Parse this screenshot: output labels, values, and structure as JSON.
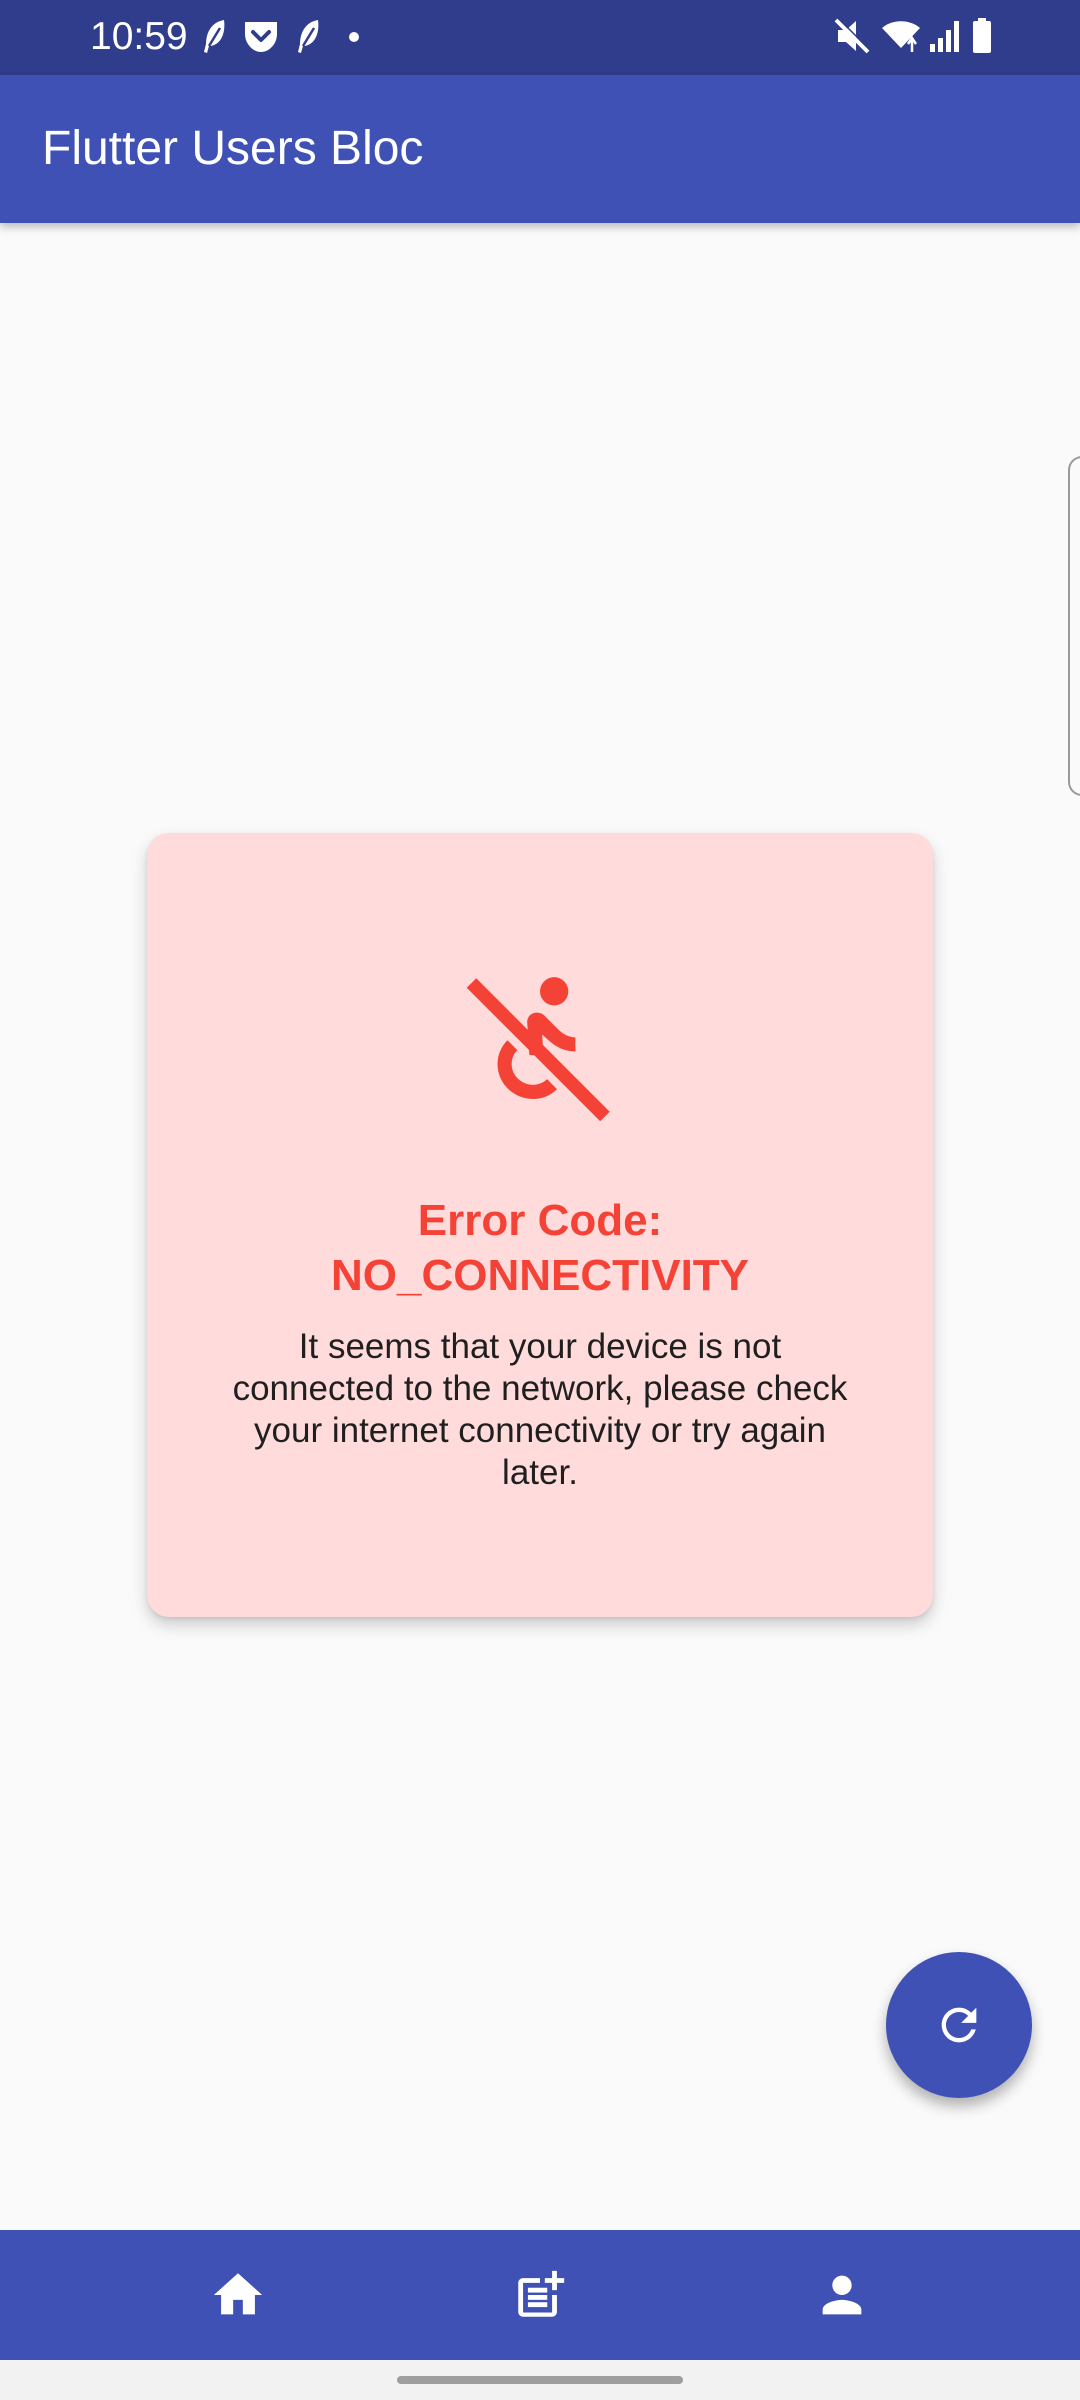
{
  "status_bar": {
    "time": "10:59",
    "notification_icons": [
      "feather-icon",
      "pocket-icon",
      "feather-icon",
      "dot-icon"
    ],
    "system_icons": [
      "mute-icon",
      "wifi-icon",
      "signal-icon",
      "battery-icon"
    ]
  },
  "app_bar": {
    "title": "Flutter Users Bloc"
  },
  "error_card": {
    "icon": "not-accessible-icon",
    "title_line1": "Error Code:",
    "title_line2": "NO_CONNECTIVITY",
    "message": "It seems that your device is not connected to the network, please check your internet connectivity or try again later."
  },
  "fab": {
    "icon": "refresh-icon"
  },
  "bottom_nav": {
    "items": [
      {
        "icon": "home-icon"
      },
      {
        "icon": "post-add-icon"
      },
      {
        "icon": "person-icon"
      }
    ]
  },
  "colors": {
    "primary": "#3f51b5",
    "status_bar": "#2f3d8c",
    "error": "#f44336",
    "error_card_bg": "#ffdbdb",
    "background": "#fafafa"
  }
}
